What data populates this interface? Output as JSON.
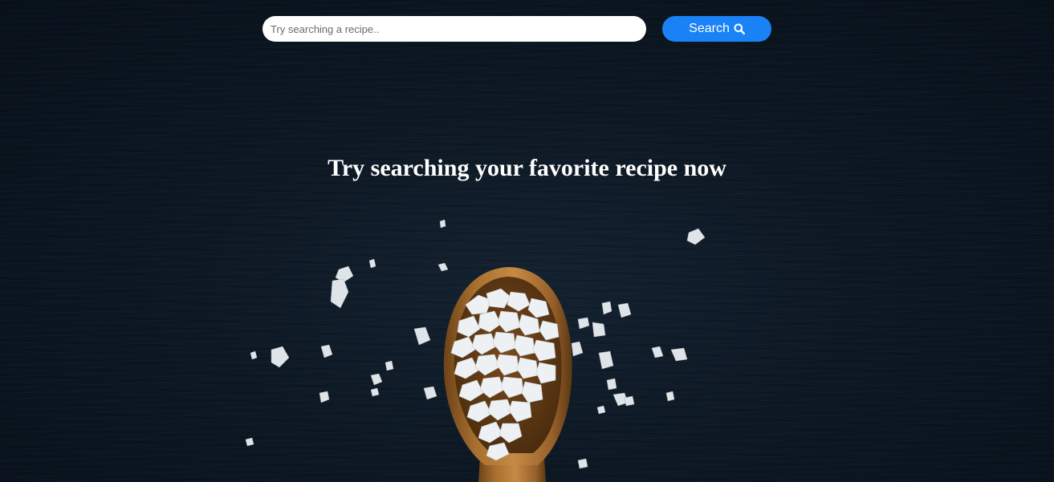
{
  "search": {
    "placeholder": "Try searching a recipe..",
    "value": "",
    "button_label": "Search"
  },
  "hero": {
    "headline": "Try searching your favorite recipe now"
  },
  "colors": {
    "background": "#0b1520",
    "accent": "#1a82f7",
    "text": "#ffffff"
  },
  "icons": {
    "search_button_icon": "search-icon"
  }
}
